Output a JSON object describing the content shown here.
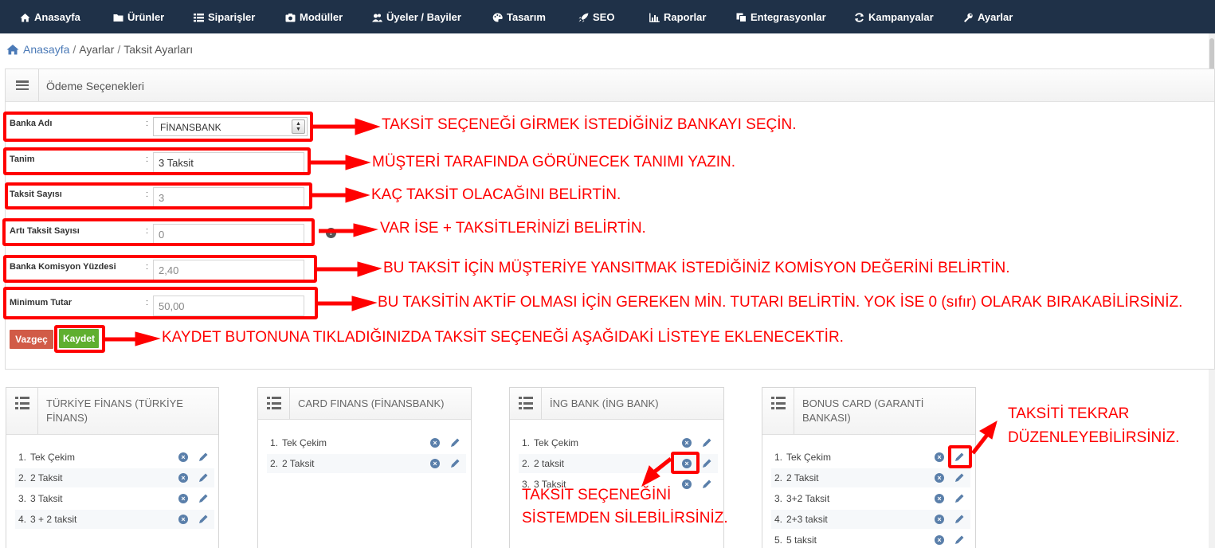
{
  "nav": {
    "items": [
      {
        "label": "Anasayfa",
        "icon": "home-icon"
      },
      {
        "label": "Ürünler",
        "icon": "folder-icon"
      },
      {
        "label": "Siparişler",
        "icon": "list-icon"
      },
      {
        "label": "Modüller",
        "icon": "camera-icon"
      },
      {
        "label": "Üyeler / Bayiler",
        "icon": "users-icon"
      },
      {
        "label": "Tasarım",
        "icon": "palette-icon"
      },
      {
        "label": "SEO",
        "icon": "rocket-icon"
      },
      {
        "label": "Raporlar",
        "icon": "chart-icon"
      },
      {
        "label": "Entegrasyonlar",
        "icon": "copy-icon"
      },
      {
        "label": "Kampanyalar",
        "icon": "refresh-icon"
      },
      {
        "label": "Ayarlar",
        "icon": "wrench-icon"
      }
    ]
  },
  "breadcrumb": {
    "home": "Anasayfa",
    "sep1": "/",
    "level1": "Ayarlar",
    "sep2": "/",
    "current": "Taksit Ayarları"
  },
  "panel": {
    "title": "Ödeme Seçenekleri"
  },
  "form": {
    "colon": ":",
    "bank": {
      "label": "Banka Adı",
      "value": "FİNANSBANK"
    },
    "name": {
      "label": "Tanim",
      "value": "3 Taksit"
    },
    "count": {
      "label": "Taksit Sayısı",
      "value": "3"
    },
    "plus": {
      "label": "Artı Taksit Sayısı",
      "value": "0"
    },
    "commission": {
      "label": "Banka Komisyon Yüzdesi",
      "value": "2,40"
    },
    "minimum": {
      "label": "Minimum Tutar",
      "value": "50,00"
    },
    "cancel_label": "Vazgeç",
    "save_label": "Kaydet"
  },
  "annotations": {
    "bank": "TAKSİT SEÇENEĞİ GİRMEK İSTEDİĞİNİZ BANKAYI SEÇİN.",
    "name": "MÜŞTERİ TARAFINDA GÖRÜNECEK TANIMI YAZIN.",
    "count": "KAÇ TAKSİT OLACAĞINI BELİRTİN.",
    "plus": "VAR İSE + TAKSİTLERİNİZİ BELİRTİN.",
    "commission": "BU TAKSİT İÇİN MÜŞTERİYE YANSITMAK İSTEDİĞİNİZ KOMİSYON DEĞERİNİ BELİRTİN.",
    "minimum": "BU TAKSİTİN AKTİF OLMASI İÇİN GEREKEN MİN. TUTARI BELİRTİN. YOK İSE 0 (sıfır) OLARAK BIRAKABİLİRSİNİZ.",
    "save": "KAYDET BUTONUNA TIKLADIĞINIZDA TAKSİT SEÇENEĞİ AŞAĞIDAKİ LİSTEYE EKLENECEKTİR.",
    "edit_line1": "TAKSİTİ TEKRAR",
    "edit_line2": "DÜZENLEYEBİLİRSİNİZ.",
    "delete_line1": "TAKSİT SEÇENEĞİNİ",
    "delete_line2": "SİSTEMDEN SİLEBİLİRSİNİZ."
  },
  "cards": [
    {
      "title_line1": "TÜRKİYE FİNANS (TÜRKİYE",
      "title_line2": "FİNANS)",
      "items": [
        {
          "n": "1.",
          "t": "Tek Çekim"
        },
        {
          "n": "2.",
          "t": "2 Taksit"
        },
        {
          "n": "3.",
          "t": "3 Taksit"
        },
        {
          "n": "4.",
          "t": "3 + 2 taksit"
        }
      ]
    },
    {
      "title_line1": "CARD FINANS (FİNANSBANK)",
      "title_line2": "",
      "items": [
        {
          "n": "1.",
          "t": "Tek Çekim"
        },
        {
          "n": "2.",
          "t": "2 Taksit"
        }
      ]
    },
    {
      "title_line1": "İNG BANK (İNG BANK)",
      "title_line2": "",
      "items": [
        {
          "n": "1.",
          "t": "Tek Çekim"
        },
        {
          "n": "2.",
          "t": "2 taksit"
        },
        {
          "n": "3.",
          "t": "3 Taksit"
        }
      ]
    },
    {
      "title_line1": "BONUS CARD (GARANTİ",
      "title_line2": "BANKASI)",
      "items": [
        {
          "n": "1.",
          "t": "Tek Çekim"
        },
        {
          "n": "2.",
          "t": "2 Taksit"
        },
        {
          "n": "3.",
          "t": "3+2 Taksit"
        },
        {
          "n": "4.",
          "t": "2+3 taksit"
        },
        {
          "n": "5.",
          "t": "5 taksit"
        }
      ]
    }
  ],
  "colors": {
    "nav_bg": "#1f3148",
    "annotation": "#ff0000",
    "cancel": "#d15b47",
    "save": "#5faf2f",
    "link": "#4b7ab7"
  }
}
